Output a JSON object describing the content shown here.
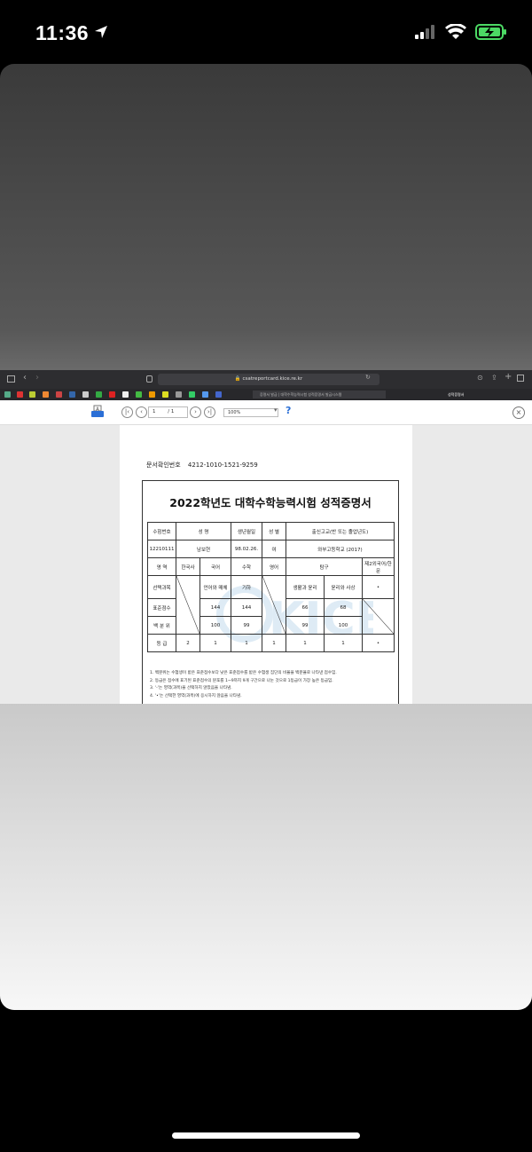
{
  "status_bar": {
    "time": "11:36"
  },
  "browser": {
    "url": "csatreportcard.kice.re.kr",
    "tabs": [
      {
        "label": "증명서 발급 | 대학수학능력시험 성적증명서 발급시스템"
      },
      {
        "label": "성적증명서"
      }
    ]
  },
  "pdf_viewer": {
    "page_current": "1",
    "page_total": "/ 1",
    "zoom": "100%"
  },
  "document": {
    "doc_id_label": "문서확인번호",
    "doc_id": "4212-1010-1521-9259",
    "title": "2022학년도 대학수학능력시험 성적증명서",
    "header_row": [
      "수험번호",
      "성  명",
      "생년월일",
      "성 별",
      "출신고교(반 또는 졸업년도)"
    ],
    "info_row": [
      "12210111",
      "남보현",
      "98.02.26.",
      "여",
      "와부고등학교 (2017)"
    ],
    "area_row": [
      "영  역",
      "한국사",
      "국어",
      "수학",
      "영어",
      "탐구",
      "제2외국어/한문"
    ],
    "subject_row": {
      "label": "선택과목",
      "korean": "언어와 매체",
      "math": "기하",
      "inquiry1": "생활과 윤리",
      "inquiry2": "윤리와 사상",
      "foreign": "•"
    },
    "standard_row": {
      "label": "표준점수",
      "korean": "144",
      "math": "144",
      "inquiry1": "66",
      "inquiry2": "68"
    },
    "percentile_row": {
      "label": "백 분 위",
      "korean": "100",
      "math": "99",
      "inquiry1": "99",
      "inquiry2": "100"
    },
    "grade_row": {
      "label": "등  급",
      "history": "2",
      "korean": "1",
      "math": "1",
      "english": "1",
      "inquiry1": "1",
      "inquiry2": "1",
      "foreign": "•"
    },
    "notes": [
      "1. 백분위는 수험생이 받은 표준점수보다 낮은 표준점수를 받은 수험생 집단의 비율을 백분율로 나타낸 점수임.",
      "2. 등급은 점수에 표기된 표준점수의 분포를 1~9까지 9개 구간으로 나눈 것으로 1등급이 가장 높은 등급임.",
      "3. '-'는 영역(과목)을 선택하지 않았음을 나타냄.",
      "4. '•'는 선택한 영역(과목)에 응시하지 않음을 나타냄."
    ],
    "watermark": "KICE"
  },
  "colors": {
    "accent_blue": "#2b6fd6",
    "watermark": "#7fb4d8",
    "battery_green": "#4cd964"
  }
}
